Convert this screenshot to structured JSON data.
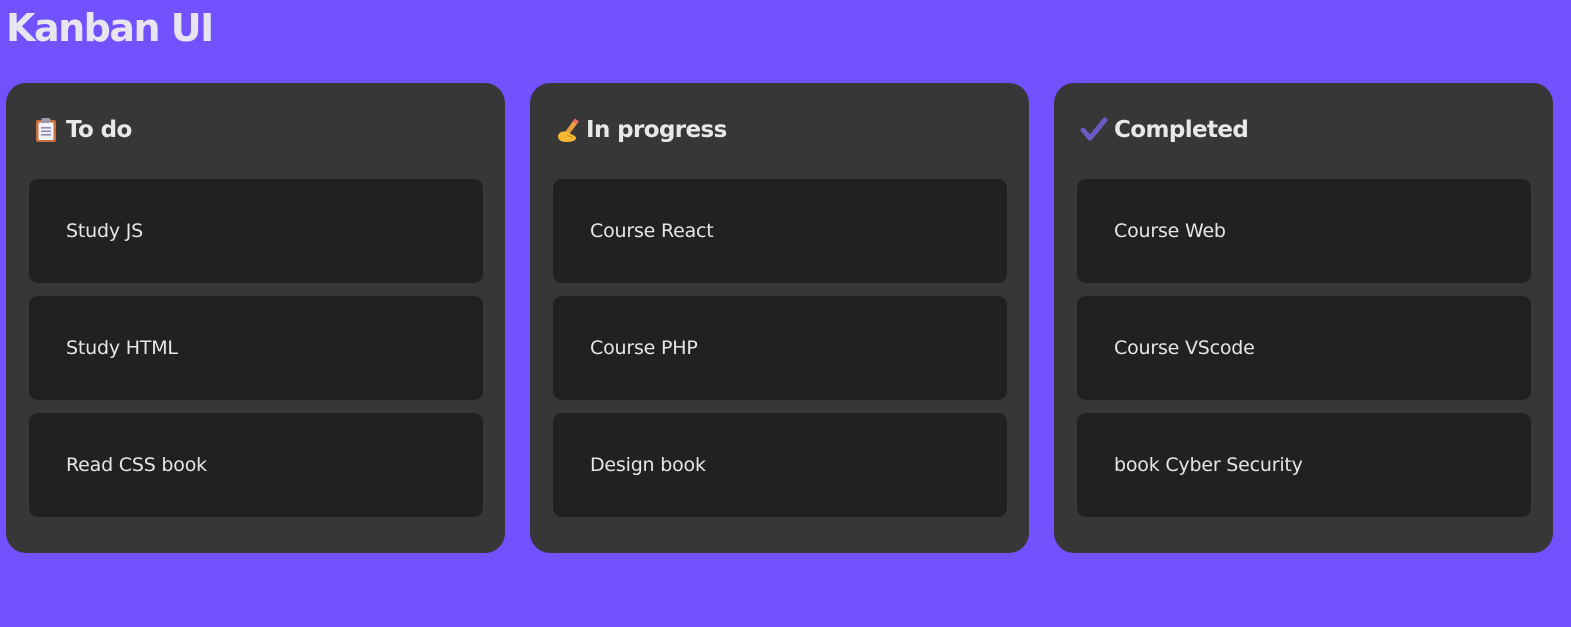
{
  "app": {
    "title": "Kanban UI"
  },
  "columns": [
    {
      "icon": "clipboard-icon",
      "title": "To do",
      "cards": [
        "Study JS",
        "Study HTML",
        "Read CSS book"
      ]
    },
    {
      "icon": "writing-hand-icon",
      "title": "In progress",
      "cards": [
        "Course React",
        "Course PHP",
        "Design book"
      ]
    },
    {
      "icon": "check-mark-icon",
      "title": "Completed",
      "cards": [
        "Course Web",
        "Course VScode",
        "book Cyber Security"
      ]
    }
  ],
  "colors": {
    "background": "#7251ff",
    "column": "#373737",
    "card": "#212121",
    "text": "#e8e8e8"
  }
}
